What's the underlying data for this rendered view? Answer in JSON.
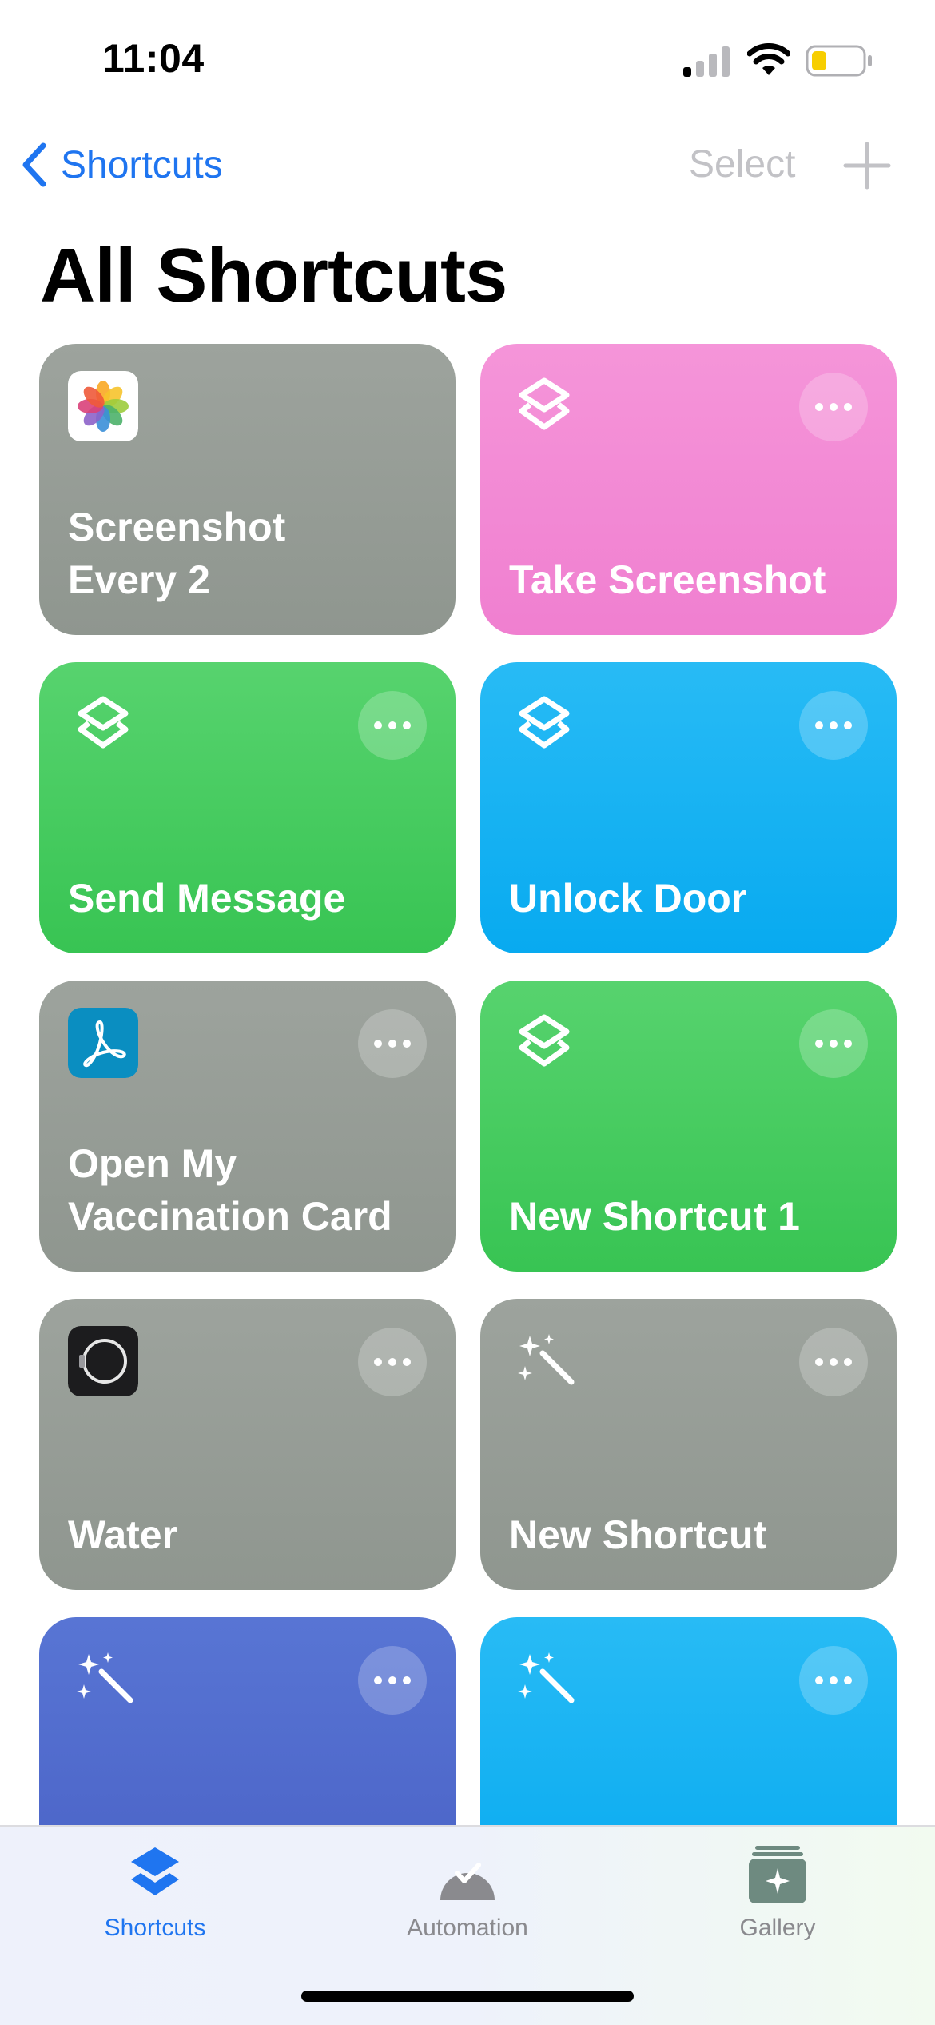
{
  "status_bar": {
    "time": "11:04"
  },
  "nav": {
    "back_label": "Shortcuts",
    "select_label": "Select"
  },
  "page": {
    "title": "All Shortcuts"
  },
  "shortcuts": [
    {
      "title": "Screenshot\nEvery 2",
      "color": "#979c96",
      "icon": "photos-app-icon",
      "has_more": false
    },
    {
      "title": "Take Screenshot",
      "color": "#f38ad3",
      "icon": "shortcuts-stack-icon",
      "has_more": true
    },
    {
      "title": "Send Message",
      "color": "#47cc61",
      "icon": "shortcuts-stack-icon",
      "has_more": true
    },
    {
      "title": "Unlock Door",
      "color": "#17b2f3",
      "icon": "shortcuts-stack-icon",
      "has_more": true
    },
    {
      "title": "Open My\nVaccination Card",
      "color": "#979c96",
      "icon": "acrobat-app-icon",
      "has_more": true
    },
    {
      "title": "New Shortcut 1",
      "color": "#47cc61",
      "icon": "shortcuts-stack-icon",
      "has_more": true
    },
    {
      "title": "Water",
      "color": "#979c96",
      "icon": "watch-app-icon",
      "has_more": true
    },
    {
      "title": "New Shortcut",
      "color": "#979c96",
      "icon": "magic-wand-icon",
      "has_more": true
    },
    {
      "title": "",
      "color": "#4f6bcd",
      "icon": "magic-wand-icon",
      "has_more": true
    },
    {
      "title": "",
      "color": "#17b2f3",
      "icon": "magic-wand-icon",
      "has_more": true
    }
  ],
  "tab_bar": {
    "tabs": [
      {
        "label": "Shortcuts",
        "active": true,
        "color": "#1f75f0"
      },
      {
        "label": "Automation",
        "active": false,
        "color": "#8a8a8e"
      },
      {
        "label": "Gallery",
        "active": false,
        "color": "#8a8a8e"
      }
    ]
  }
}
